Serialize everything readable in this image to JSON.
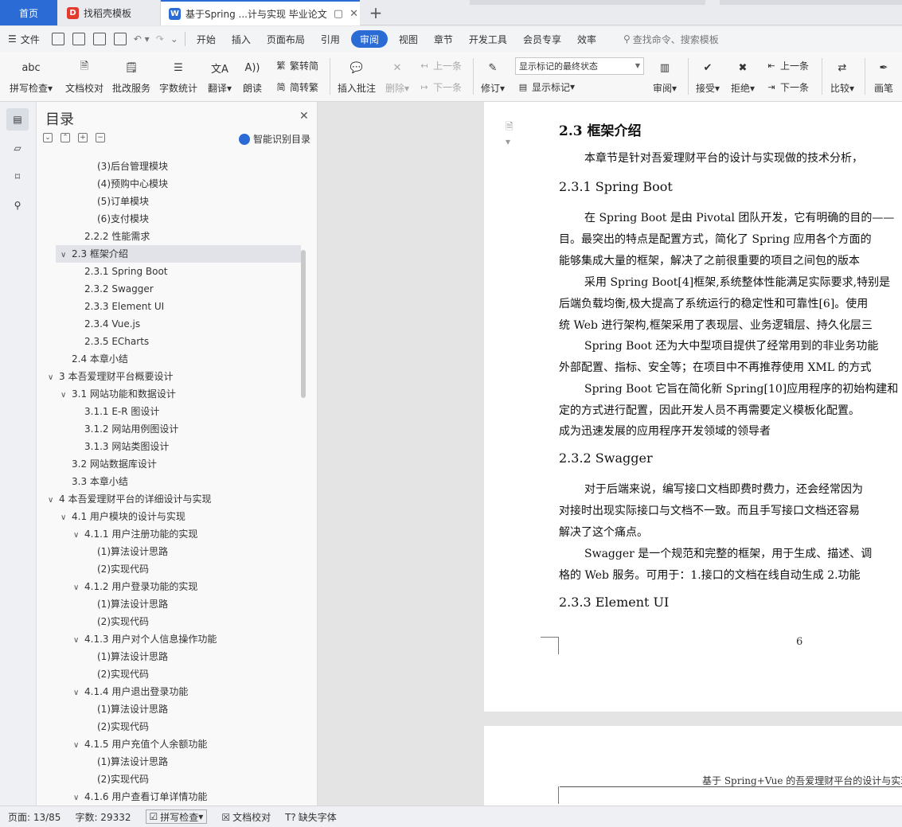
{
  "tabs": {
    "home": "首页",
    "template": "找稻壳模板",
    "document": "基于Spring ...计与实现 毕业论文"
  },
  "menu": {
    "file": "文件",
    "items": [
      "开始",
      "插入",
      "页面布局",
      "引用",
      "审阅",
      "视图",
      "章节",
      "开发工具",
      "会员专享",
      "效率"
    ],
    "active": "审阅",
    "search": "查找命令、搜索模板"
  },
  "ribbon": {
    "spellcheck": "拼写检查",
    "doccheck": "文档校对",
    "review_service": "批改服务",
    "wordcount": "字数统计",
    "translate": "翻译",
    "read_aloud": "朗读",
    "to_traditional": "繁转简",
    "to_simplified": "简转繁",
    "insert_comment": "插入批注",
    "delete": "删除",
    "prev_comment": "上一条",
    "next_comment": "下一条",
    "revise": "修订",
    "markup_state": "显示标记的最终状态",
    "show_markup": "显示标记",
    "review_pane": "审阅",
    "accept": "接受",
    "reject": "拒绝",
    "prev_change": "上一条",
    "next_change": "下一条",
    "compare": "比较",
    "pen": "画笔"
  },
  "nav": {
    "title": "目录",
    "ai_identify": "智能识别目录",
    "items": [
      {
        "text": "(3)后台管理模块",
        "level": 4
      },
      {
        "text": "(4)预购中心模块",
        "level": 4
      },
      {
        "text": "(5)订单模块",
        "level": 4
      },
      {
        "text": "(6)支付模块",
        "level": 4
      },
      {
        "text": "2.2.2  性能需求",
        "level": 3
      },
      {
        "text": "2.3  框架介绍",
        "level": 2,
        "expanded": true,
        "selected": true
      },
      {
        "text": "2.3.1 Spring Boot",
        "level": 3
      },
      {
        "text": "2.3.2 Swagger",
        "level": 3
      },
      {
        "text": "2.3.3 Element UI",
        "level": 3
      },
      {
        "text": "2.3.4 Vue.js",
        "level": 3
      },
      {
        "text": "2.3.5 ECharts",
        "level": 3
      },
      {
        "text": "2.4  本章小结",
        "level": 2
      },
      {
        "text": "3  本吾爱理财平台概要设计",
        "level": 1,
        "expanded": true
      },
      {
        "text": "3.1  网站功能和数据设计",
        "level": 2,
        "expanded": true
      },
      {
        "text": "3.1.1 E-R 图设计",
        "level": 3
      },
      {
        "text": "3.1.2  网站用例图设计",
        "level": 3
      },
      {
        "text": "3.1.3  网站类图设计",
        "level": 3
      },
      {
        "text": "3.2  网站数据库设计",
        "level": 2
      },
      {
        "text": "3.3  本章小结",
        "level": 2
      },
      {
        "text": "4  本吾爱理财平台的详细设计与实现",
        "level": 1,
        "expanded": true
      },
      {
        "text": "4.1  用户模块的设计与实现",
        "level": 2,
        "expanded": true
      },
      {
        "text": "4.1.1  用户注册功能的实现",
        "level": 3,
        "expanded": true
      },
      {
        "text": "(1)算法设计思路",
        "level": 4
      },
      {
        "text": "(2)实现代码",
        "level": 4
      },
      {
        "text": "4.1.2  用户登录功能的实现",
        "level": 3,
        "expanded": true
      },
      {
        "text": "(1)算法设计思路",
        "level": 4
      },
      {
        "text": "(2)实现代码",
        "level": 4
      },
      {
        "text": "4.1.3  用户对个人信息操作功能",
        "level": 3,
        "expanded": true
      },
      {
        "text": "(1)算法设计思路",
        "level": 4
      },
      {
        "text": "(2)实现代码",
        "level": 4
      },
      {
        "text": "4.1.4  用户退出登录功能",
        "level": 3,
        "expanded": true
      },
      {
        "text": "(1)算法设计思路",
        "level": 4
      },
      {
        "text": "(2)实现代码",
        "level": 4
      },
      {
        "text": "4.1.5  用户充值个人余额功能",
        "level": 3,
        "expanded": true
      },
      {
        "text": "(1)算法设计思路",
        "level": 4
      },
      {
        "text": "(2)实现代码",
        "level": 4
      },
      {
        "text": "4.1.6  用户查看订单详情功能",
        "level": 3,
        "expanded": true
      }
    ]
  },
  "document": {
    "h_23": "2.3  框架介绍",
    "intro": "本章节是针对吾爱理财平台的设计与实现做的技术分析，",
    "h_231": "2.3.1 Spring Boot",
    "p1_l1": "在 Spring Boot 是由 Pivotal 团队开发，它有明确的目的——",
    "p1_l2": "目。最突出的特点是配置方式，简化了 Spring 应用各个方面的",
    "p1_l3": "能够集成大量的框架，解决了之前很重要的项目之间包的版本",
    "p2_l1": "采用 Spring Boot[4]框架,系统整体性能满足实际要求,特别是",
    "p2_l2": "后端负载均衡,极大提高了系统运行的稳定性和可靠性[6]。使用",
    "p2_l3": "统 Web 进行架构,框架采用了表现层、业务逻辑层、持久化层三",
    "p3_l1": "Spring Boot 还为大中型项目提供了经常用到的非业务功能",
    "p3_l2": "外部配置、指标、安全等；在项目中不再推荐使用 XML 的方式",
    "p4_l1": "Spring Boot 它旨在简化新 Spring[10]应用程序的初始构建和",
    "p4_l2": "定的方式进行配置，因此开发人员不再需要定义模板化配置。",
    "p4_l3": "成为迅速发展的应用程序开发领域的领导者",
    "h_232": "2.3.2 Swagger",
    "p5_l1": "对于后端来说，编写接口文档即费时费力，还会经常因为",
    "p5_l2": "对接时出现实际接口与文档不一致。而且手写接口文档还容易",
    "p5_l3": "解决了这个痛点。",
    "p6_l1": "Swagger 是一个规范和完整的框架，用于生成、描述、调",
    "p6_l2": "格的  Web  服务。可用于：1.接口的文档在线自动生成 2.功能",
    "h_233": "2.3.3 Element UI",
    "page_number": "6",
    "page2_header": "基于 Spring+Vue 的吾爱理财平台的设计与实现"
  },
  "status": {
    "page": "页面: 13/85",
    "words": "字数: 29332",
    "spell": "拼写检查",
    "proof": "文档校对",
    "missing_font": "缺失字体"
  },
  "colors": {
    "accent": "#2a6bd6",
    "panel_bg": "#f9f9f9",
    "doc_bg": "#e4e4e4"
  }
}
